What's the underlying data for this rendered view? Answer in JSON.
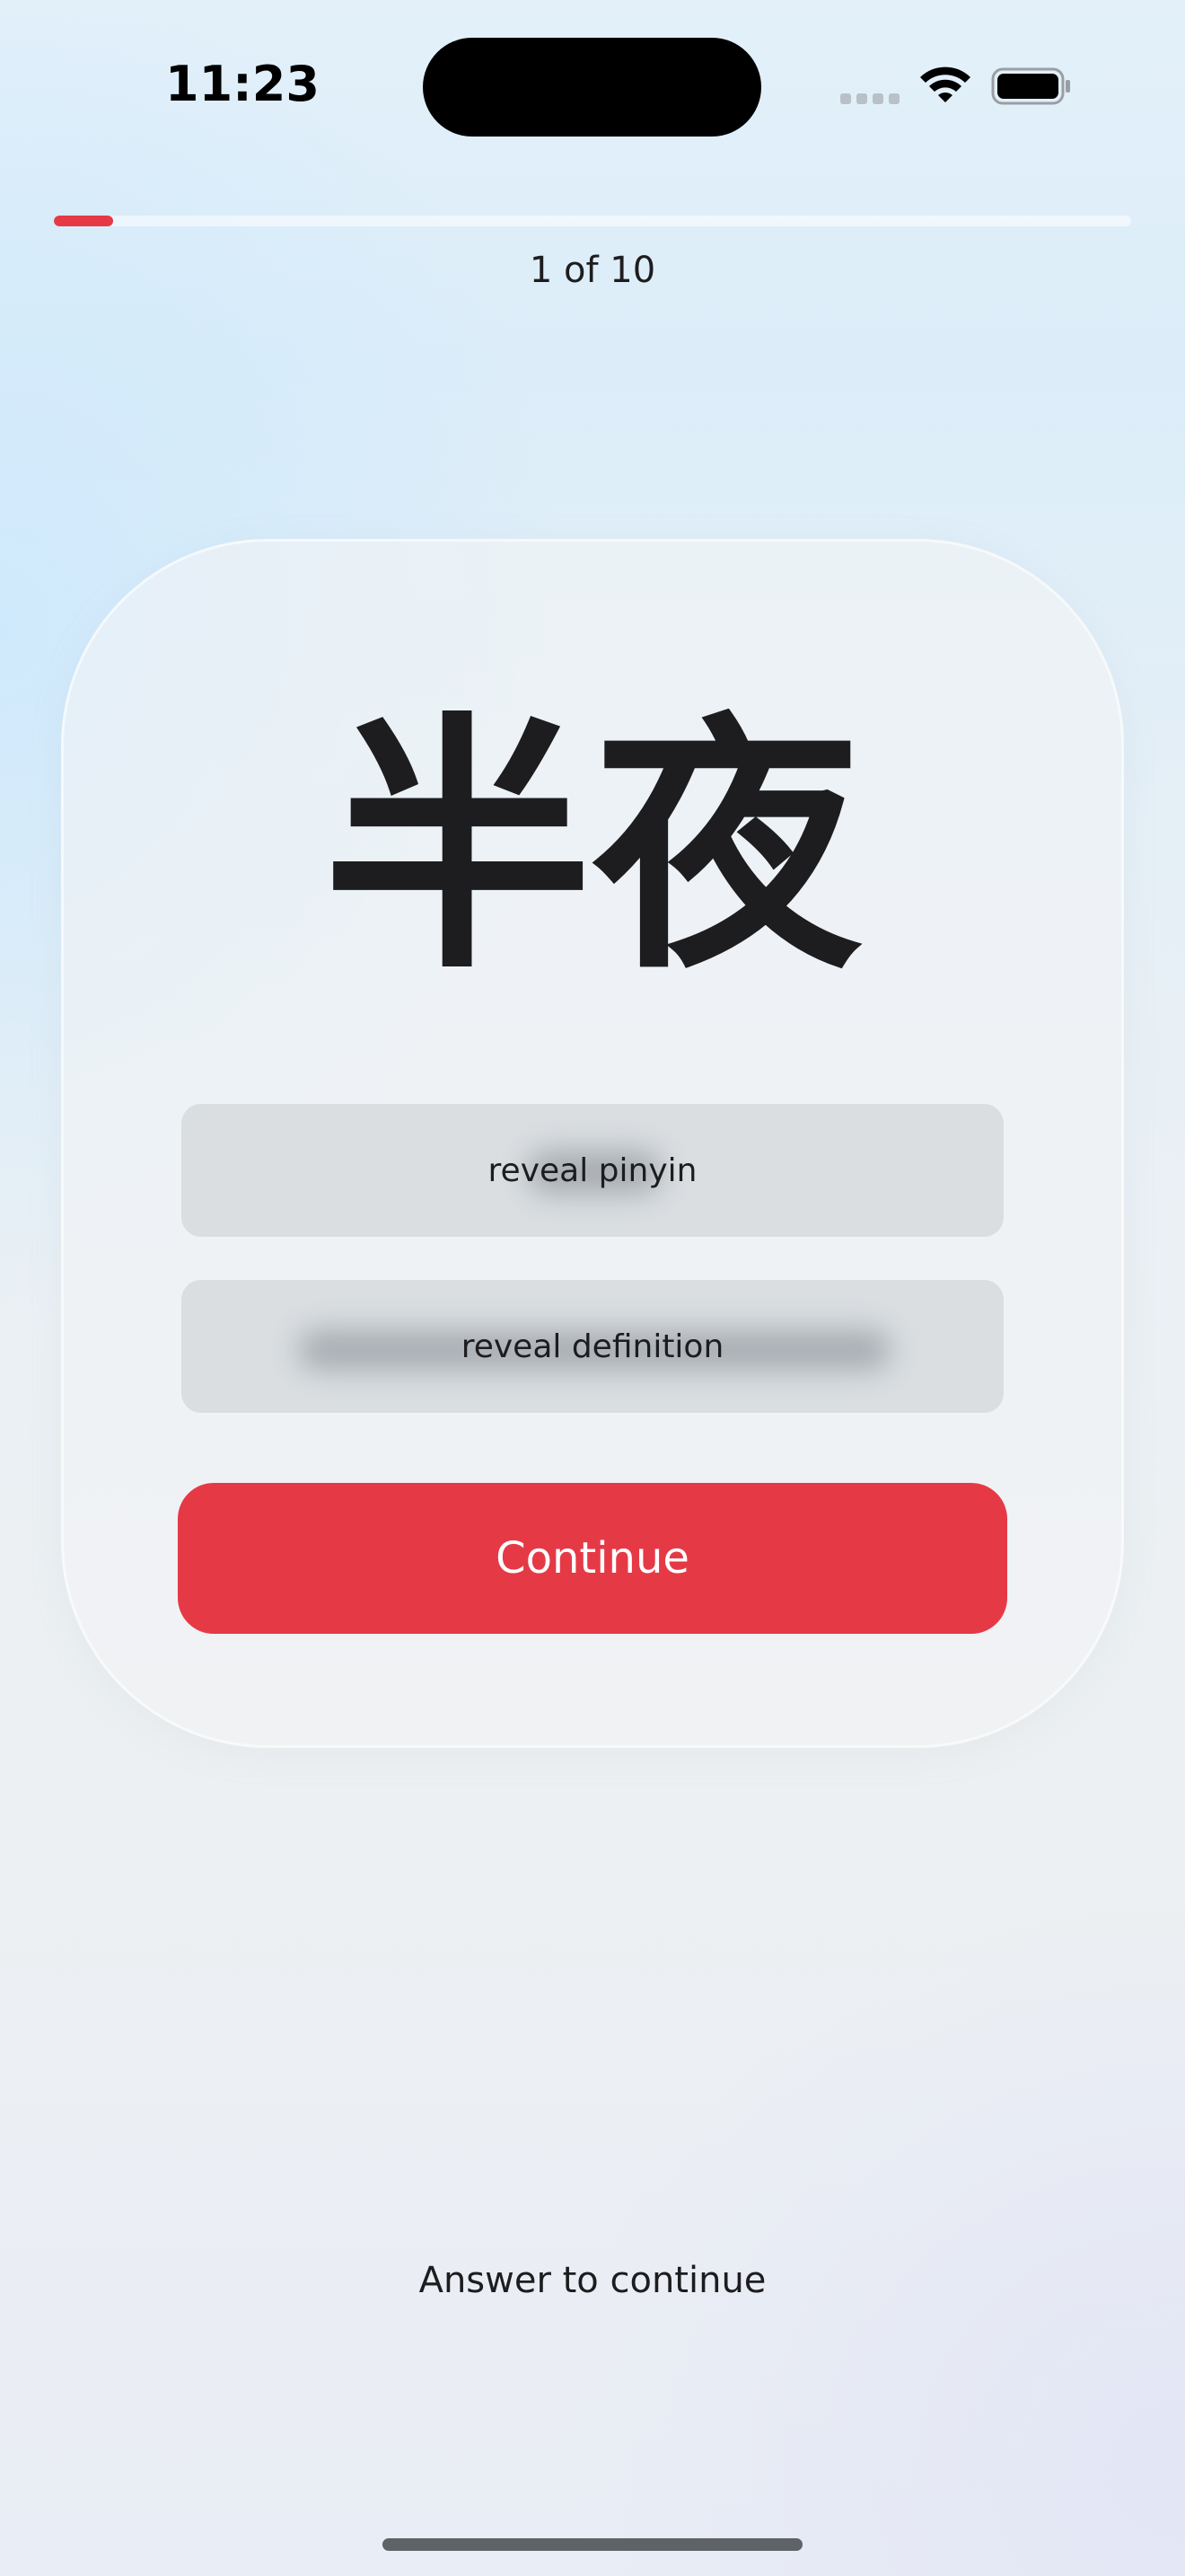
{
  "status_bar": {
    "time": "11:23",
    "icons": [
      "cellular-signal-icon",
      "wifi-icon",
      "battery-icon"
    ]
  },
  "progress": {
    "label": "1 of 10",
    "current": 1,
    "total": 10,
    "fraction": 0.055,
    "accent_color": "#e63946"
  },
  "card": {
    "word": "半夜",
    "reveal_pinyin_label": "reveal pinyin",
    "reveal_definition_label": "reveal definition",
    "continue_label": "Continue"
  },
  "footer": {
    "hint": "Answer to continue"
  }
}
